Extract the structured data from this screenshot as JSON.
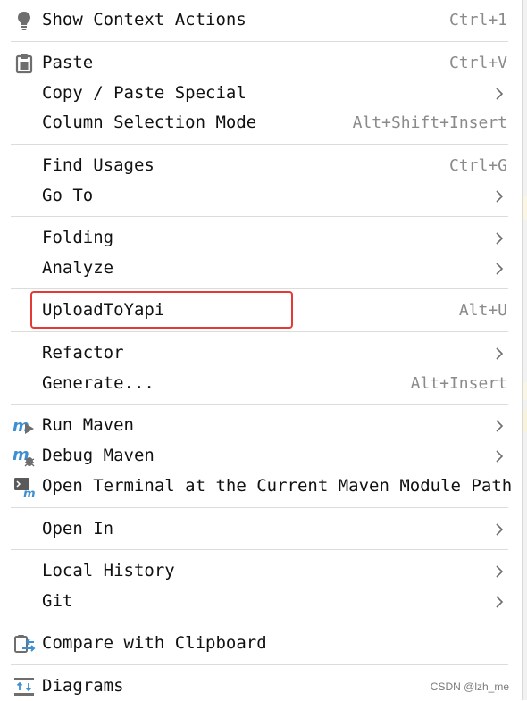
{
  "menu": {
    "show_context_actions": {
      "label": "Show Context Actions",
      "shortcut": "Ctrl+1",
      "icon": "lightbulb-icon"
    },
    "paste": {
      "label": "Paste",
      "shortcut": "Ctrl+V",
      "icon": "clipboard-icon"
    },
    "copy_paste_special": {
      "label": "Copy / Paste Special"
    },
    "column_selection_mode": {
      "label": "Column Selection Mode",
      "shortcut": "Alt+Shift+Insert"
    },
    "find_usages": {
      "label": "Find Usages",
      "shortcut": "Ctrl+G"
    },
    "go_to": {
      "label": "Go To"
    },
    "folding": {
      "label": "Folding"
    },
    "analyze": {
      "label": "Analyze"
    },
    "upload_to_yapi": {
      "label": "UploadToYapi",
      "shortcut": "Alt+U"
    },
    "refactor": {
      "label": "Refactor"
    },
    "generate": {
      "label": "Generate...",
      "shortcut": "Alt+Insert"
    },
    "run_maven": {
      "label": "Run Maven",
      "icon": "maven-run-icon"
    },
    "debug_maven": {
      "label": "Debug Maven",
      "icon": "maven-debug-icon"
    },
    "open_terminal": {
      "label": "Open Terminal at the Current Maven Module Path",
      "icon": "maven-terminal-icon"
    },
    "open_in": {
      "label": "Open In"
    },
    "local_history": {
      "label": "Local History"
    },
    "git": {
      "label": "Git"
    },
    "compare_clipboard": {
      "label": "Compare with Clipboard",
      "icon": "compare-clipboard-icon"
    },
    "diagrams": {
      "label": "Diagrams",
      "icon": "diagrams-icon"
    }
  },
  "colors": {
    "highlight": "#e53935",
    "maven_blue": "#3d8fd1",
    "shortcut_gray": "#8a8a8a"
  },
  "watermark": "CSDN @lzh_me"
}
